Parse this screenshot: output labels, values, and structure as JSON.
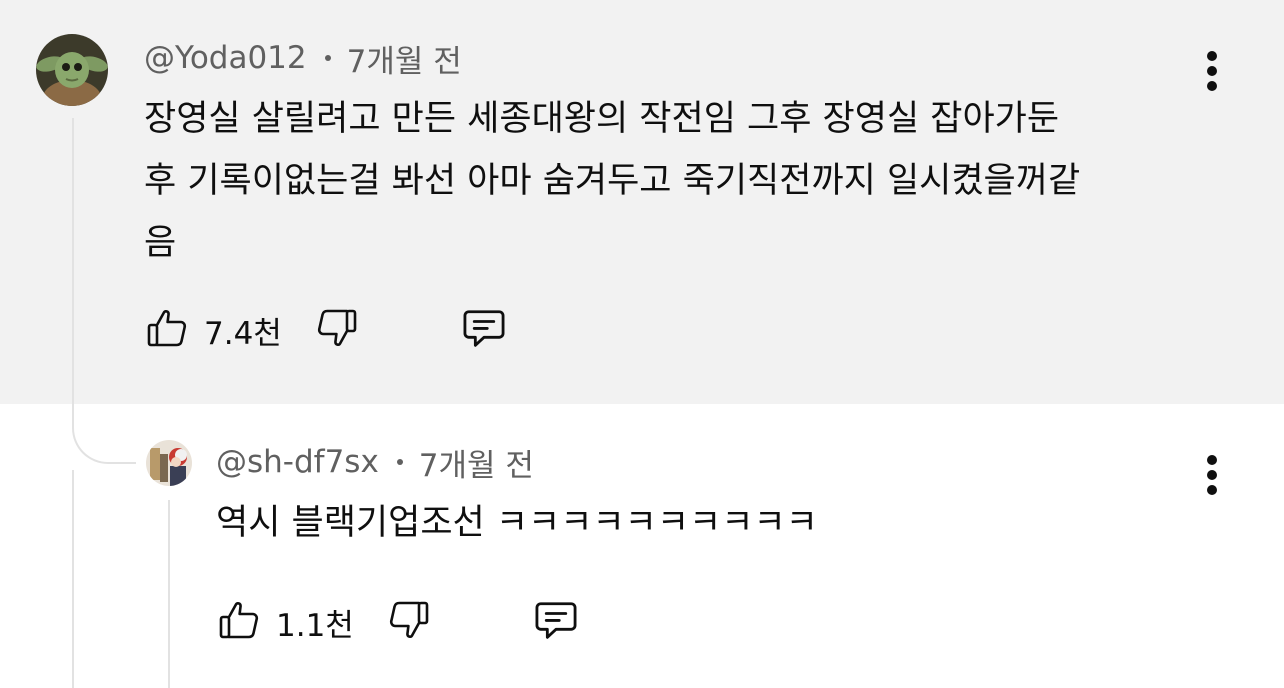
{
  "top_comment": {
    "handle": "@Yoda012",
    "time": "7개월 전",
    "lines": [
      "장영실 살릴려고 만든 세종대왕의 작전임  그후 장영실 잡아가둔",
      "후 기록이없는걸 봐선 아마 숨겨두고 죽기직전까지 일시켰을꺼같",
      "음"
    ],
    "likes": "7.4천"
  },
  "reply": {
    "handle": "@sh-df7sx",
    "time": "7개월 전",
    "text": "역시 블랙기업조선 ㅋㅋㅋㅋㅋㅋㅋㅋㅋㅋ",
    "likes": "1.1천"
  },
  "icons": {
    "like": "thumbs-up-icon",
    "dislike": "thumbs-down-icon",
    "reply": "comment-icon",
    "menu": "more-vertical-icon"
  },
  "colors": {
    "top_background": "#f2f2f2",
    "meta_text": "#606060",
    "thread_line": "#e2e2e2"
  }
}
